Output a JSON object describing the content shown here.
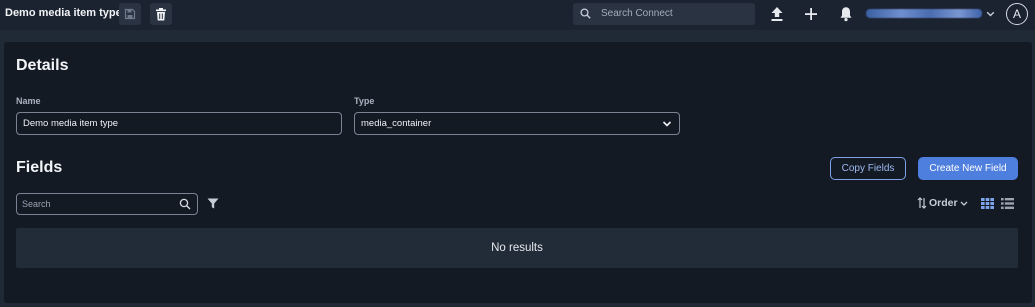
{
  "topbar": {
    "title": "Demo media item type",
    "search_placeholder": "Search Connect",
    "avatar_initial": "A",
    "icons": [
      "save-icon",
      "trash-icon",
      "search-icon",
      "upload-icon",
      "plus-icon",
      "bell-icon",
      "chevron-down-icon"
    ]
  },
  "details": {
    "heading": "Details",
    "name_label": "Name",
    "name_value": "Demo media item type",
    "type_label": "Type",
    "type_value": "media_container"
  },
  "fields": {
    "heading": "Fields",
    "copy_button": "Copy Fields",
    "create_button": "Create New Field",
    "search_placeholder": "Search",
    "order_label": "Order",
    "empty_text": "No results"
  },
  "colors": {
    "background": "#202936",
    "panel": "#141a24",
    "accent": "#4f7fde",
    "results_bg": "#222b38"
  }
}
